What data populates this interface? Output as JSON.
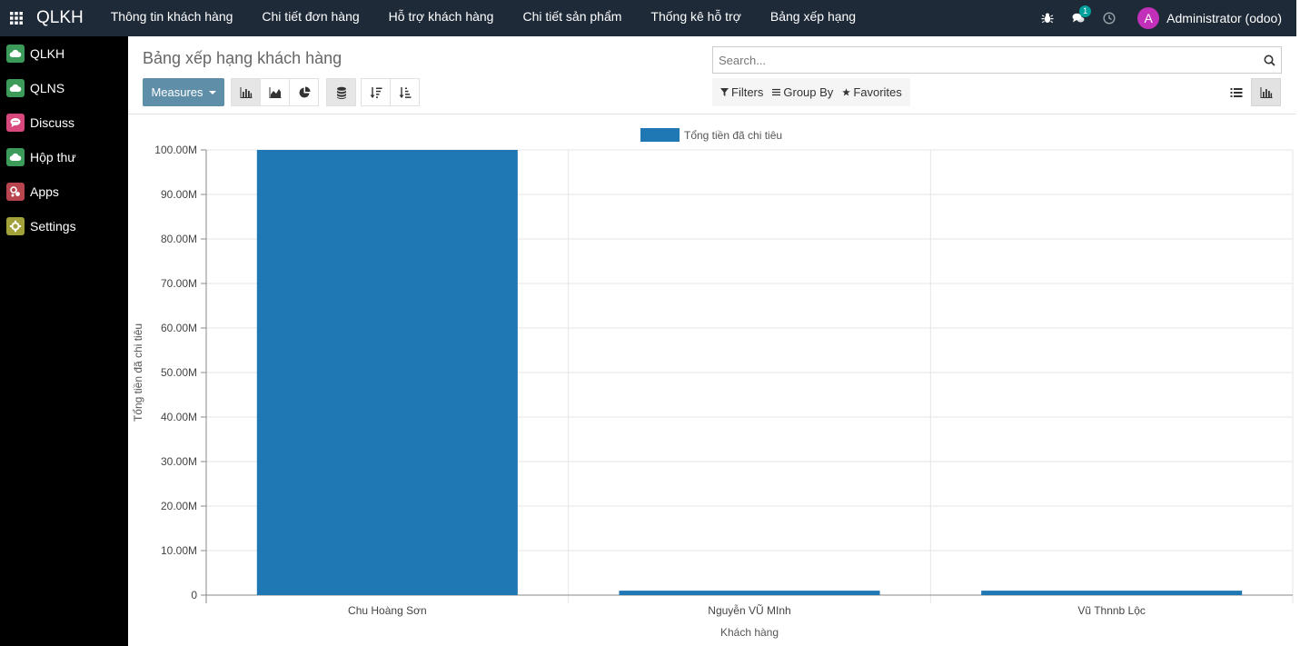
{
  "navbar": {
    "brand": "QLKH",
    "menu": [
      {
        "label": "Thông tin khách hàng"
      },
      {
        "label": "Chi tiết đơn hàng"
      },
      {
        "label": "Hỗ trợ khách hàng"
      },
      {
        "label": "Chi tiết sản phẩm"
      },
      {
        "label": "Thống kê hỗ trợ"
      },
      {
        "label": "Bảng xếp hạng"
      }
    ],
    "chat_badge": "1",
    "user_initial": "A",
    "user_name": "Administrator (odoo)"
  },
  "sidebar": {
    "items": [
      {
        "label": "QLKH",
        "icon": "cloud-icon",
        "color": "#3c9b58"
      },
      {
        "label": "QLNS",
        "icon": "cloud-icon",
        "color": "#3c9b58"
      },
      {
        "label": "Discuss",
        "icon": "chat-icon",
        "color": "#d9487c"
      },
      {
        "label": "Hộp thư",
        "icon": "cloud-icon",
        "color": "#3c9b58"
      },
      {
        "label": "Apps",
        "icon": "apps-gear-icon",
        "color": "#b8454d"
      },
      {
        "label": "Settings",
        "icon": "gear-icon",
        "color": "#a3a23a"
      }
    ]
  },
  "control": {
    "title": "Bảng xếp hạng khách hàng",
    "search_placeholder": "Search...",
    "measures_label": "Measures",
    "filters_label": "Filters",
    "group_by_label": "Group By",
    "favorites_label": "Favorites"
  },
  "colors": {
    "navbar": "#1f2a38",
    "sidebar": "#000000",
    "accent": "#5f8fa8",
    "bar": "#1f77b4"
  },
  "chart_data": {
    "type": "bar",
    "categories": [
      "Chu Hoàng Sơn",
      "Nguyễn VŨ MInh",
      "Vũ Thnnb Lộc"
    ],
    "series": [
      {
        "name": "Tổng tiền đã chi tiêu",
        "values": [
          100000000,
          1000000,
          1000000
        ]
      }
    ],
    "xlabel": "Khách hàng",
    "ylabel": "Tổng tiền đã chi tiêu",
    "ylim": [
      0,
      100000000
    ],
    "yticks": [
      "0",
      "10.00M",
      "20.00M",
      "30.00M",
      "40.00M",
      "50.00M",
      "60.00M",
      "70.00M",
      "80.00M",
      "90.00M",
      "100.00M"
    ],
    "grid": true,
    "legend": "top-center"
  }
}
